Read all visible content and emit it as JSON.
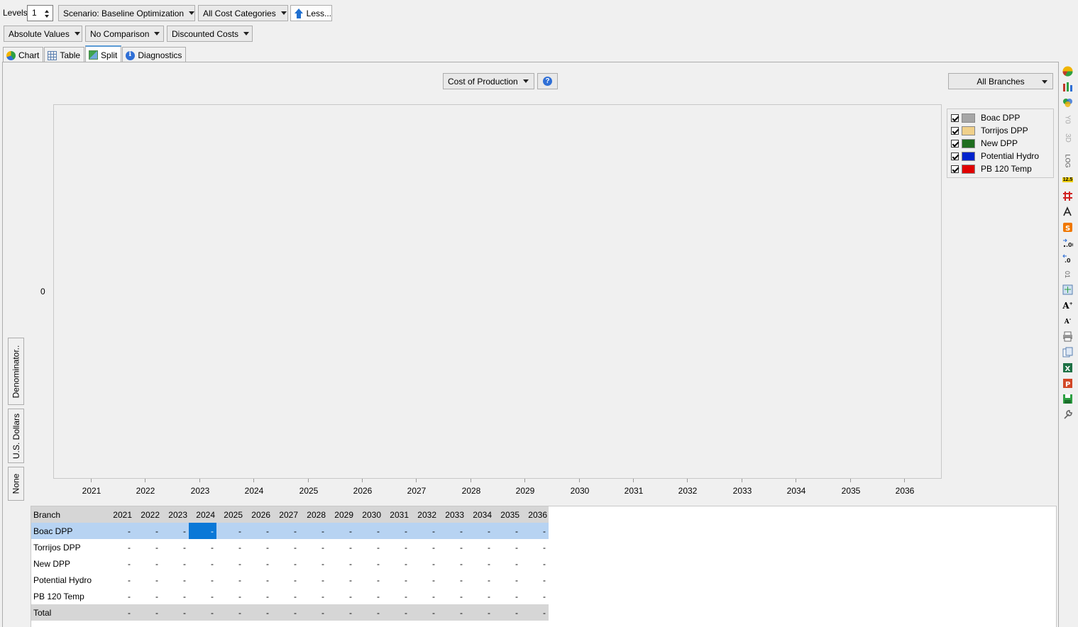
{
  "toolbar": {
    "levels_label": "Levels:",
    "levels_value": "1",
    "scenario": "Scenario: Baseline Optimization",
    "categories": "All Cost Categories",
    "less": "Less...",
    "values_mode": "Absolute Values",
    "comparison": "No Comparison",
    "costs": "Discounted Costs"
  },
  "tabs": [
    {
      "label": "Chart",
      "icon": "chart-icon"
    },
    {
      "label": "Table",
      "icon": "table-icon"
    },
    {
      "label": "Split",
      "icon": "split-icon",
      "active": true
    },
    {
      "label": "Diagnostics",
      "icon": "diagnostics-icon"
    }
  ],
  "chart_controls": {
    "variable": "Cost of Production",
    "branches": "All Branches"
  },
  "side_tabs": {
    "denominator": "Denominator..",
    "unit": "U.S. Dollars",
    "none": "None"
  },
  "legend": [
    {
      "label": "Boac DPP",
      "color": "#a6a6a6"
    },
    {
      "label": "Torrijos DPP",
      "color": "#f0d08a"
    },
    {
      "label": "New DPP",
      "color": "#1f6e1f"
    },
    {
      "label": "Potential Hydro",
      "color": "#0022cc"
    },
    {
      "label": "PB 120 Temp",
      "color": "#e00000"
    }
  ],
  "chart_data": {
    "type": "bar",
    "categories": [
      "2021",
      "2022",
      "2023",
      "2024",
      "2025",
      "2026",
      "2027",
      "2028",
      "2029",
      "2030",
      "2031",
      "2032",
      "2033",
      "2034",
      "2035",
      "2036"
    ],
    "y_tick_labels": [
      "0"
    ],
    "series": [
      {
        "name": "Boac DPP",
        "values": [
          0,
          0,
          0,
          0,
          0,
          0,
          0,
          0,
          0,
          0,
          0,
          0,
          0,
          0,
          0,
          0
        ]
      },
      {
        "name": "Torrijos DPP",
        "values": [
          0,
          0,
          0,
          0,
          0,
          0,
          0,
          0,
          0,
          0,
          0,
          0,
          0,
          0,
          0,
          0
        ]
      },
      {
        "name": "New DPP",
        "values": [
          0,
          0,
          0,
          0,
          0,
          0,
          0,
          0,
          0,
          0,
          0,
          0,
          0,
          0,
          0,
          0
        ]
      },
      {
        "name": "Potential Hydro",
        "values": [
          0,
          0,
          0,
          0,
          0,
          0,
          0,
          0,
          0,
          0,
          0,
          0,
          0,
          0,
          0,
          0
        ]
      },
      {
        "name": "PB 120 Temp",
        "values": [
          0,
          0,
          0,
          0,
          0,
          0,
          0,
          0,
          0,
          0,
          0,
          0,
          0,
          0,
          0,
          0
        ]
      }
    ],
    "legend": "right",
    "grid": false
  },
  "table": {
    "header": "Branch",
    "years": [
      "2021",
      "2022",
      "2023",
      "2024",
      "2025",
      "2026",
      "2027",
      "2028",
      "2029",
      "2030",
      "2031",
      "2032",
      "2033",
      "2034",
      "2035",
      "2036"
    ],
    "rows": [
      {
        "name": "Boac DPP",
        "values": [
          "-",
          "-",
          "-",
          "-",
          "-",
          "-",
          "-",
          "-",
          "-",
          "-",
          "-",
          "-",
          "-",
          "-",
          "-",
          "-"
        ]
      },
      {
        "name": "Torrijos DPP",
        "values": [
          "-",
          "-",
          "-",
          "-",
          "-",
          "-",
          "-",
          "-",
          "-",
          "-",
          "-",
          "-",
          "-",
          "-",
          "-",
          "-"
        ]
      },
      {
        "name": "New DPP",
        "values": [
          "-",
          "-",
          "-",
          "-",
          "-",
          "-",
          "-",
          "-",
          "-",
          "-",
          "-",
          "-",
          "-",
          "-",
          "-",
          "-"
        ]
      },
      {
        "name": "Potential Hydro",
        "values": [
          "-",
          "-",
          "-",
          "-",
          "-",
          "-",
          "-",
          "-",
          "-",
          "-",
          "-",
          "-",
          "-",
          "-",
          "-",
          "-"
        ]
      },
      {
        "name": "PB 120 Temp",
        "values": [
          "-",
          "-",
          "-",
          "-",
          "-",
          "-",
          "-",
          "-",
          "-",
          "-",
          "-",
          "-",
          "-",
          "-",
          "-",
          "-"
        ]
      }
    ],
    "total": {
      "name": "Total",
      "values": [
        "-",
        "-",
        "-",
        "-",
        "-",
        "-",
        "-",
        "-",
        "-",
        "-",
        "-",
        "-",
        "-",
        "-",
        "-",
        "-"
      ]
    },
    "selected_row": 0,
    "selected_col": 3
  },
  "right_toolbar": {
    "y0_label": "Y0",
    "three_d_label": "3D",
    "log_label": "LOG",
    "decimals_label": "12.5"
  }
}
